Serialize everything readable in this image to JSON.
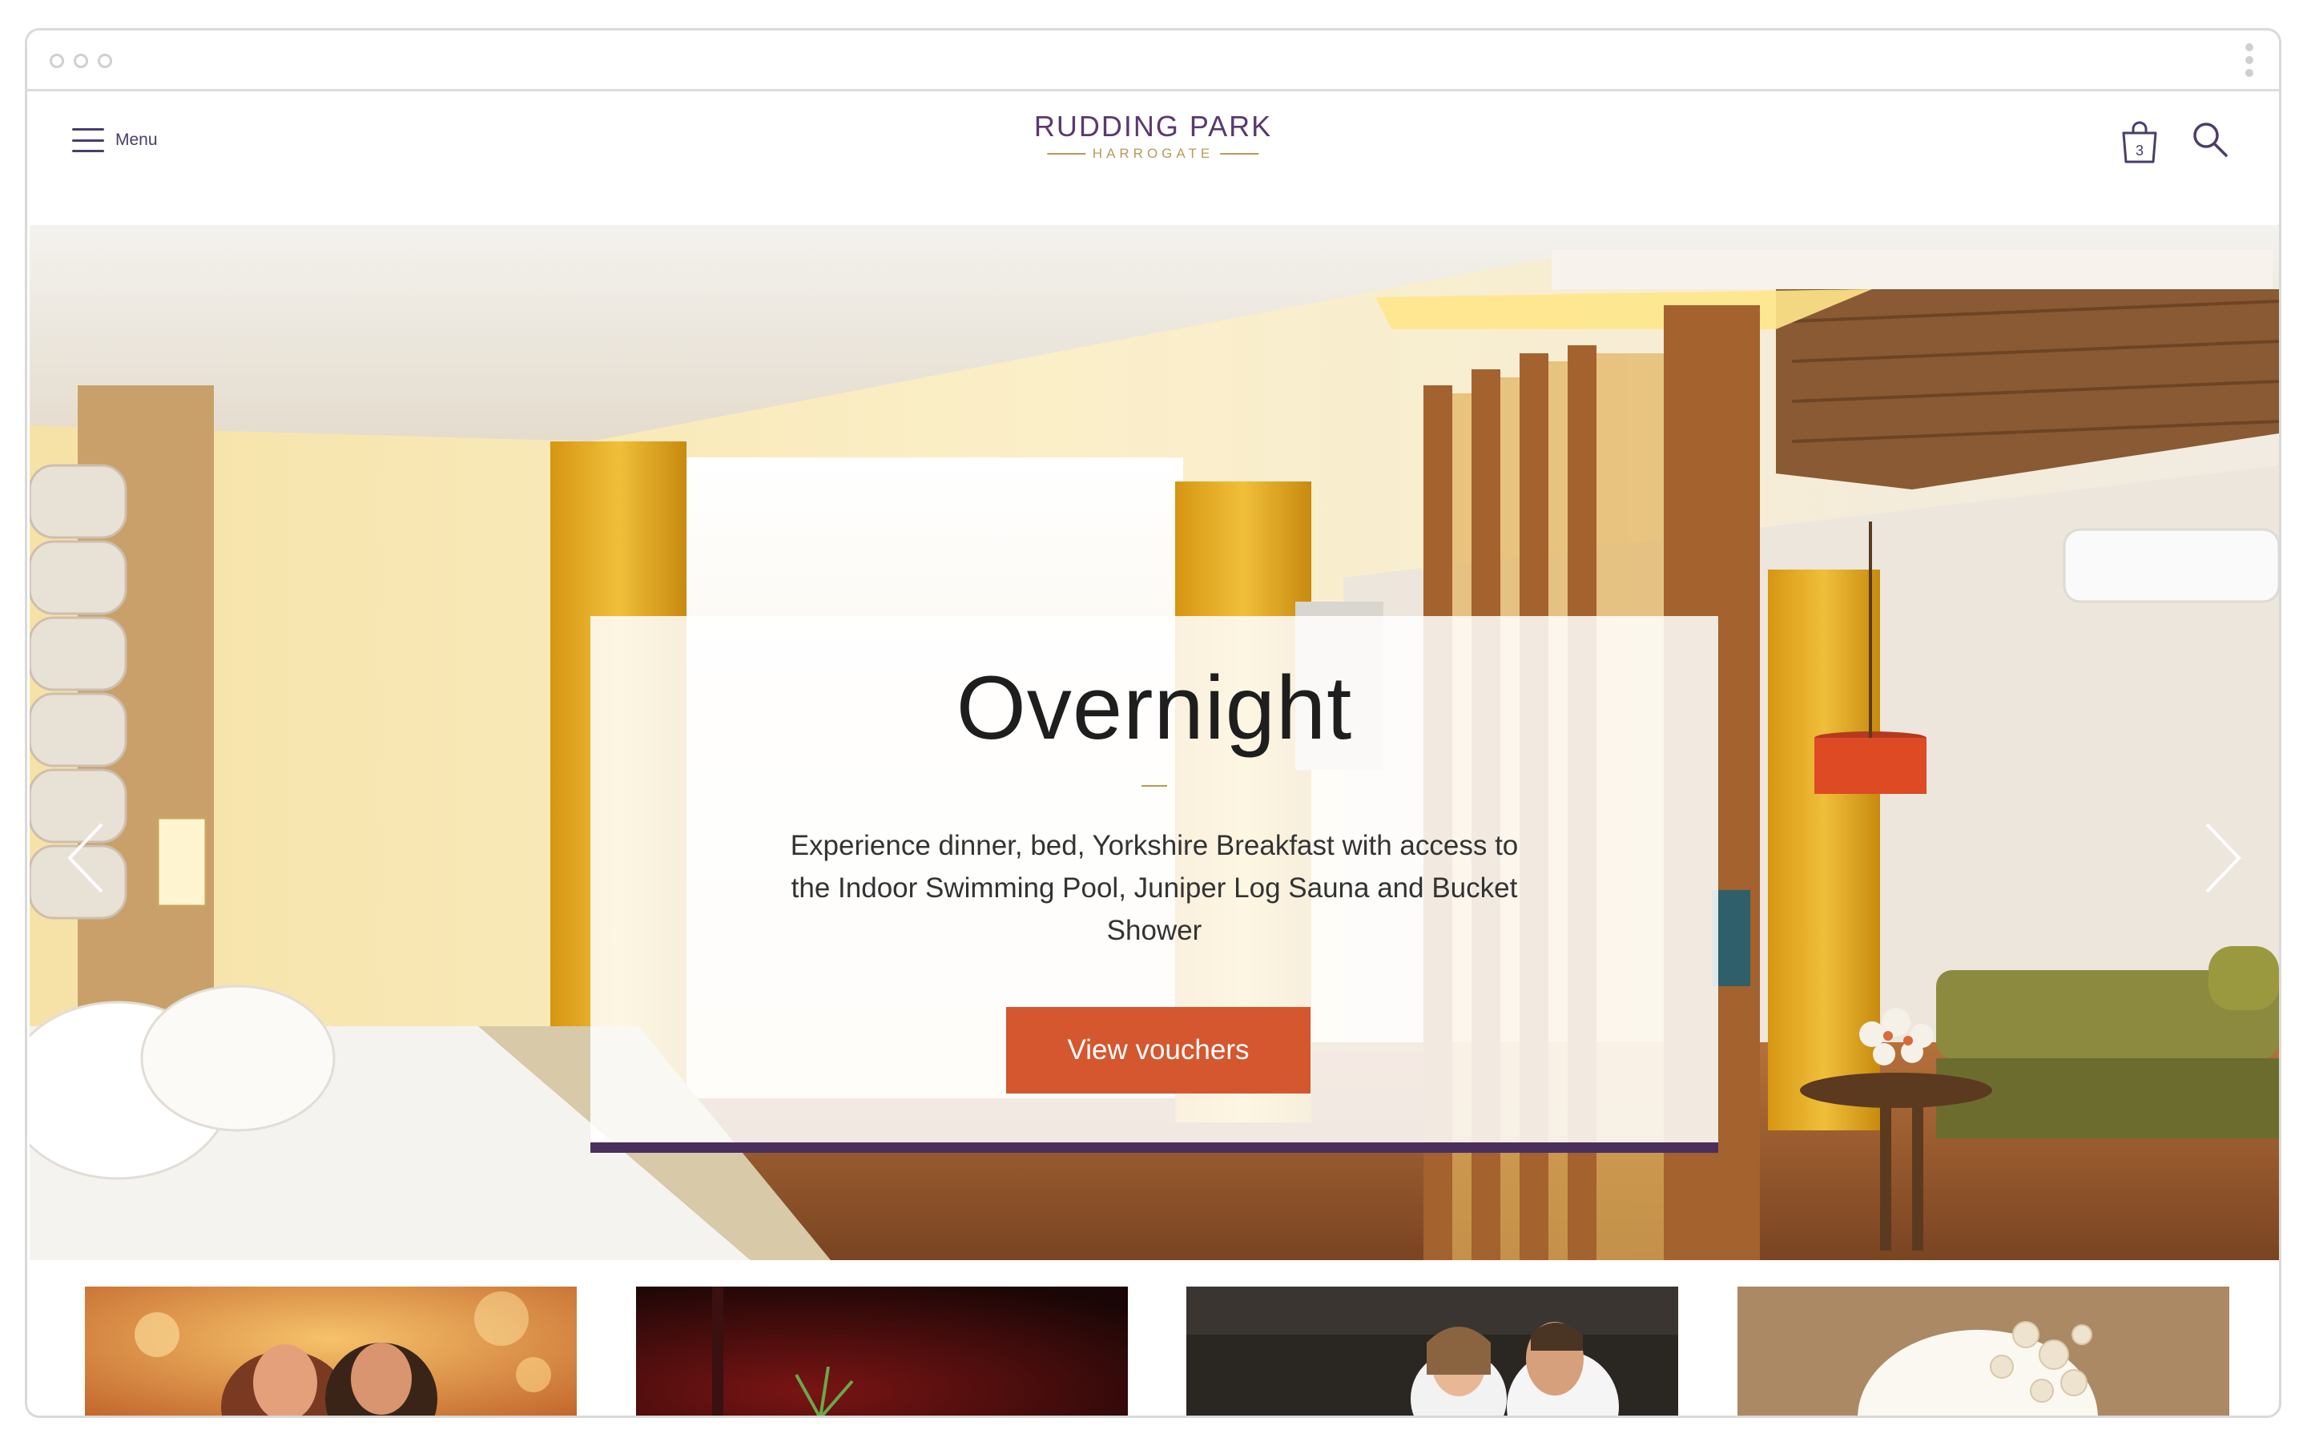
{
  "header": {
    "menu_label": "Menu",
    "logo_main": "RUDDING PARK",
    "logo_sub": "HARROGATE",
    "basket_count": "3"
  },
  "hero": {
    "title": "Overnight",
    "description": "Experience dinner, bed, Yorkshire Breakfast with access to the Indoor Swimming Pool, Juniper Log Sauna and Bucket Shower",
    "cta_label": "View vouchers"
  },
  "colors": {
    "brand_purple": "#4a2f5e",
    "accent_gold": "#b79a5a",
    "cta_orange": "#d4572f"
  },
  "thumbnails": [
    {
      "icon": "couple-photo"
    },
    {
      "icon": "dining-photo"
    },
    {
      "icon": "spa-couple-photo"
    },
    {
      "icon": "wedding-cake-photo"
    }
  ]
}
